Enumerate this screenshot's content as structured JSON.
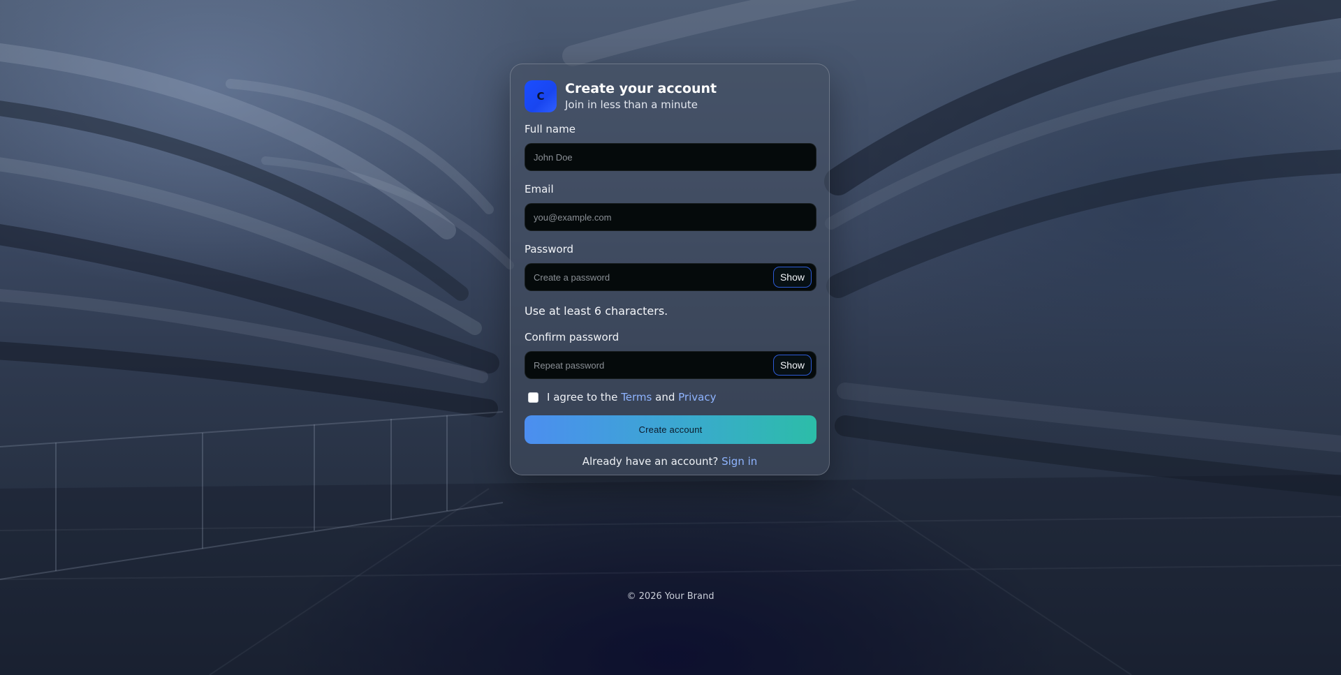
{
  "header": {
    "logo_letter": "C",
    "title": "Create your account",
    "subtitle": "Join in less than a minute"
  },
  "form": {
    "full_name": {
      "label": "Full name",
      "placeholder": "John Doe",
      "value": ""
    },
    "email": {
      "label": "Email",
      "placeholder": "you@example.com",
      "value": ""
    },
    "password": {
      "label": "Password",
      "placeholder": "Create a password",
      "value": "",
      "toggle_label": "Show"
    },
    "password_hint": "Use at least 6 characters.",
    "confirm_password": {
      "label": "Confirm password",
      "placeholder": "Repeat password",
      "value": "",
      "toggle_label": "Show"
    },
    "agree": {
      "checked": false,
      "prefix": "I agree to the ",
      "terms_link": "Terms",
      "middle": " and ",
      "privacy_link": "Privacy"
    },
    "submit_label": "Create account",
    "signin_prompt": "Already have an account? ",
    "signin_link": "Sign in"
  },
  "footer": {
    "text": "© 2026 Your Brand"
  },
  "colors": {
    "accent_link": "#8fb4ff",
    "brand_logo": "#1a4dff",
    "button_gradient_start": "#4c8ef0",
    "button_gradient_end": "#2cbda8",
    "show_button_border": "#2d5bd6"
  },
  "icons": {
    "logo": "brand-logo-icon"
  }
}
